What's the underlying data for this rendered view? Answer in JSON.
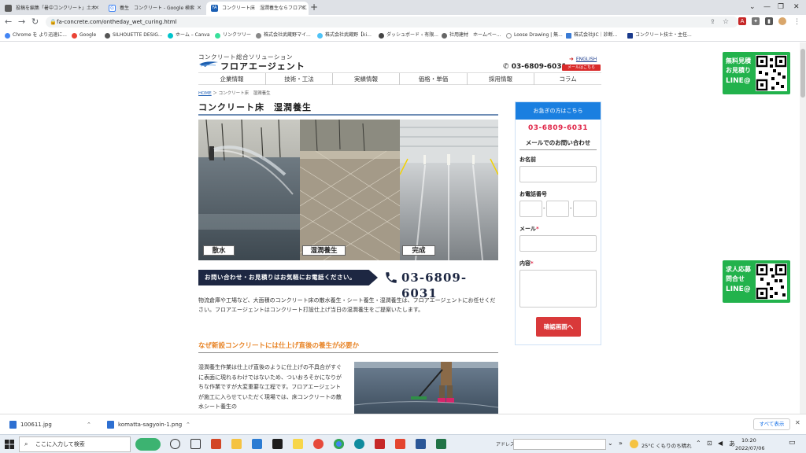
{
  "browser": {
    "tabs": [
      {
        "title": "投稿を編集「暑中コンクリート」土木",
        "color": "#5a5a5a"
      },
      {
        "title": "養生　コンクリート - Google 検索",
        "color": "#4285f4"
      },
      {
        "title": "コンクリート床　湿潤養生ならフロアエ",
        "color": "#1a5fb4",
        "fav_text": "FA"
      }
    ],
    "new_tab": "+",
    "url": "fa-concrete.com/ontheday_wet_curing.html",
    "bookmarks": [
      "Chrome を より迅速に...",
      "Google",
      "SILHOUETTE DESIG...",
      "ホーム – Canva",
      "リンクツリー",
      "株式会社武蔵野マイ...",
      "株式会社武蔵野【ki...",
      "ダッシュボード ‹ 有限...",
      "社用建材　ホームペー...",
      "Loose Drawing | 無...",
      "株式会社JIC｜診断...",
      "コンクリート技士・主任..."
    ]
  },
  "site": {
    "logo_sub": "コンクリート総合ソリューション",
    "logo_main": "フロアエージェント",
    "phone": "03-6809-6031",
    "english": "ENGLISH",
    "mail_button": "メールはこちら",
    "nav": [
      "企業情報",
      "技術・工法",
      "実績情報",
      "価格・単価",
      "採用情報",
      "コラム"
    ],
    "breadcrumb_home": "HOME",
    "breadcrumb_rest": " ＞ コンクリート床　湿潤養生",
    "title": "コンクリート床　湿潤養生",
    "photo_labels": [
      "散水",
      "湿潤養生",
      "完成"
    ],
    "banner_text": "お問い合わせ・お見積りはお気軽にお電話ください。",
    "banner_phone": "03-6809-6031",
    "intro": "物流倉庫や工場など、大面積のコンクリート床の散水養生・シート養生・湿潤養生は、フロアエージェントにお任せください。フロアエージェントはコンクリート打設仕上げ当日の湿潤養生をご提案いたします。",
    "h2": "なぜ新設コンクリートには仕上げ直後の養生が必要か",
    "body2": "湿潤養生作業は仕上げ直後のように仕上げの不具合がすぐに表面に現れるわけではないため、ついおろそかになりがちな作業ですが大変重要な工程です。フロアエージェントが施工に入らせていただく現場では、床コンクリートの散水シート養生の"
  },
  "sidebar": {
    "header": "お急ぎの方はこちら",
    "phone": "03-6809-6031",
    "mail_heading": "メールでのお問い合わせ",
    "name_label": "お名前",
    "tel_label": "お電話番号",
    "tel_sep": "-",
    "mail_label": "メール",
    "content_label": "内容",
    "required_mark": "*",
    "submit": "確認画面へ"
  },
  "line_widgets": [
    {
      "lines": [
        "無料見積",
        "お見積り",
        "LINE@"
      ]
    },
    {
      "lines": [
        "求人応募",
        "問合せ",
        "LINE@"
      ]
    }
  ],
  "downloads": {
    "items": [
      "100611.jpg",
      "komatta-sagyoin-1.png"
    ],
    "show_all": "すべて表示"
  },
  "taskbar": {
    "search_placeholder": "ここに入力して検索",
    "address_label": "アドレス",
    "weather": "25°C  くもりのち晴れ",
    "time": "10:20",
    "date": "2022/07/06"
  },
  "colors": {
    "accent_blue": "#1a7fe0",
    "line_green": "#22b24c",
    "phone_red": "#e0284a",
    "heading_orange": "#e8862a",
    "banner_navy": "#1d2742"
  }
}
